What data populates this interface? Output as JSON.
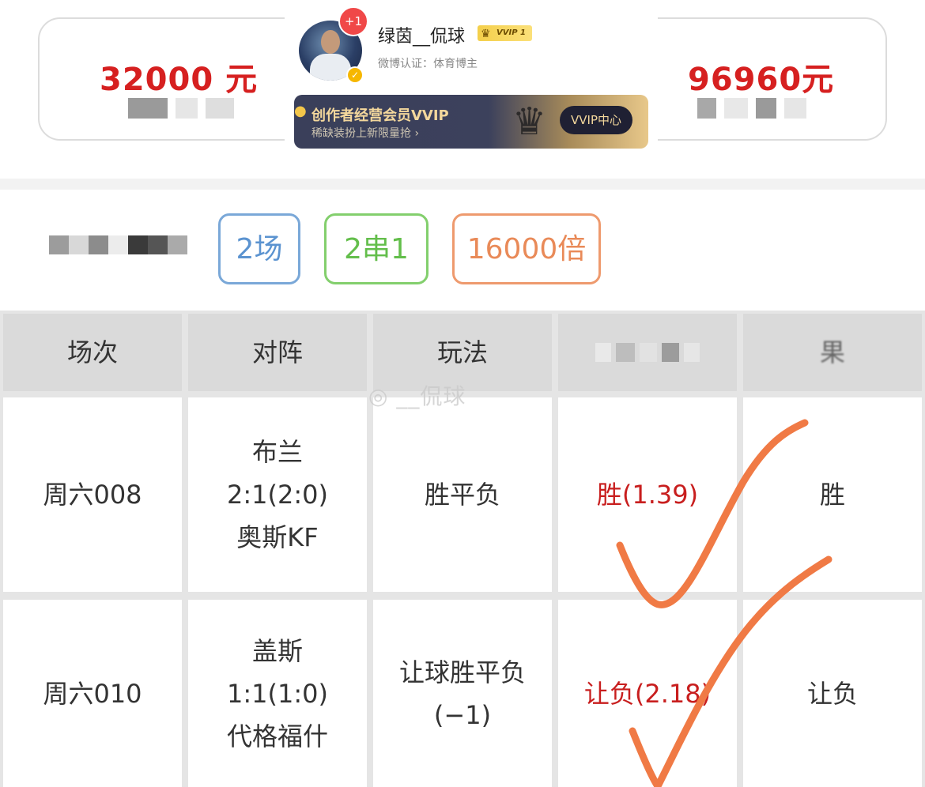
{
  "summary": {
    "left_amount": "32000 元",
    "right_amount": "96960元"
  },
  "profile": {
    "avatar_badge": "+1",
    "username": "绿茵__侃球",
    "vvip_label": "VVIP 1",
    "certification": "微博认证：体育博主",
    "banner": {
      "title": "创作者经营会员VVIP",
      "subtitle": "稀缺装扮上新限量抢 ›",
      "button": "VVIP中心"
    }
  },
  "tags": {
    "matches": "2场",
    "parlay": "2串1",
    "multiplier": "16000倍"
  },
  "table": {
    "headers": [
      "场次",
      "对阵",
      "玩法",
      "",
      "果"
    ],
    "rows": [
      {
        "match_no": "周六008",
        "home": "布兰",
        "score": "2:1(2:0)",
        "away": "奥斯KF",
        "play": "胜平负",
        "play_line2": "",
        "pick": "胜(1.39)",
        "result": "胜"
      },
      {
        "match_no": "周六010",
        "home": "盖斯",
        "score": "1:1(1:0)",
        "away": "代格福什",
        "play": "让球胜平负",
        "play_line2": "(−1)",
        "pick": "让负(2.18)",
        "result": "让负"
      }
    ]
  },
  "watermark": "__侃球",
  "colors": {
    "amount": "#d62020",
    "pick": "#c81e1e",
    "tag_blue": "#5b93d0",
    "tag_green": "#63be4b",
    "tag_orange": "#e98a58",
    "check_marks": "#f07a45"
  }
}
